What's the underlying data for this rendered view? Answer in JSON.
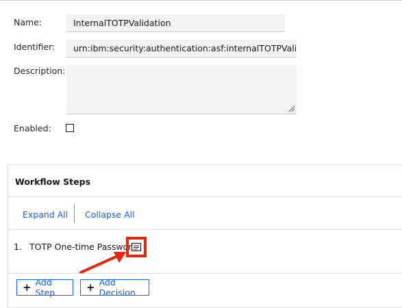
{
  "form": {
    "name_label": "Name:",
    "name_value": "InternalTOTPValidation",
    "identifier_label": "Identifier:",
    "identifier_value": "urn:ibm:security:authentication:asf:internalTOTPValidati",
    "description_label": "Description:",
    "description_value": "",
    "enabled_label": "Enabled:",
    "enabled_checked": false
  },
  "workflow": {
    "title": "Workflow Steps",
    "expand_all": "Expand All",
    "collapse_all": "Collapse All",
    "steps": [
      {
        "number": "1.",
        "name": "TOTP One-time Password"
      }
    ],
    "add_step": "Add Step",
    "add_decision": "Add Decision"
  },
  "colors": {
    "accent": "#0f62fe",
    "highlight": "#e8250c"
  }
}
